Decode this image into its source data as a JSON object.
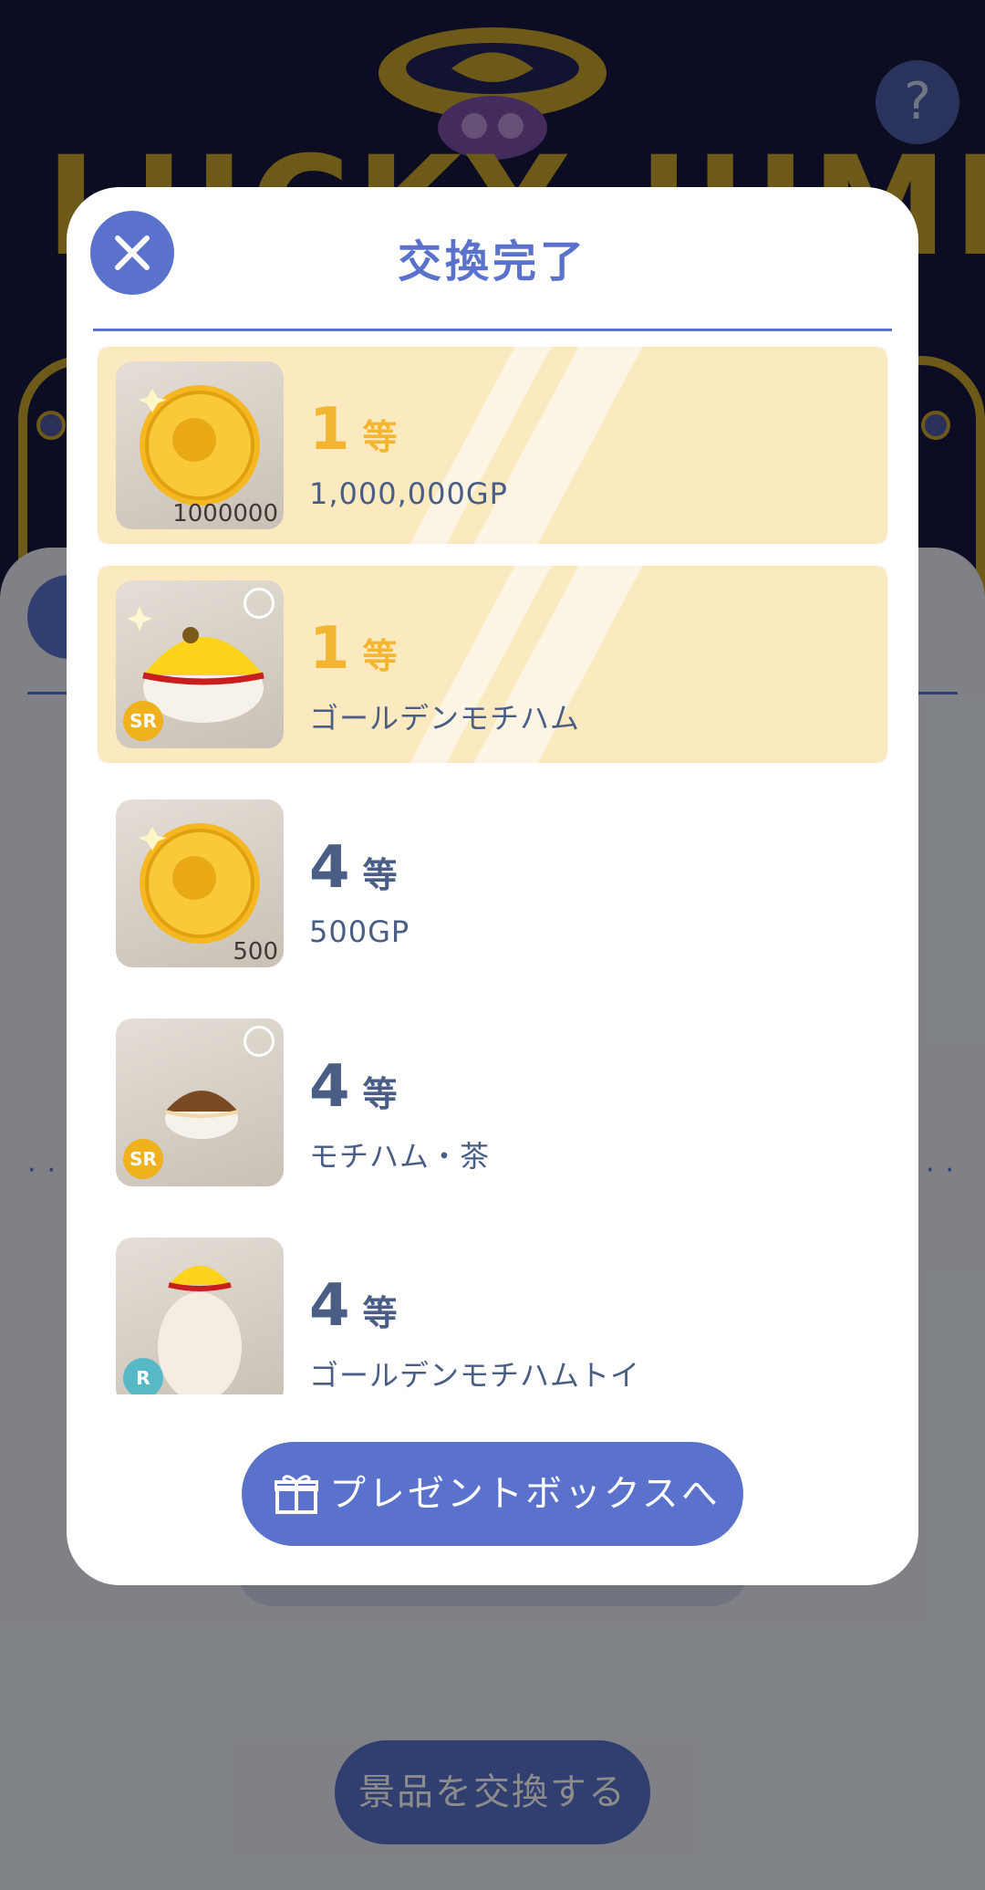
{
  "background": {
    "title_left": "LUCKY",
    "title_right": "JUMP",
    "help_label": "?",
    "exchange_button_label": "景品を交換する"
  },
  "modal": {
    "title": "交換完了",
    "close_icon": "close-icon",
    "items": [
      {
        "rank": "1",
        "rank_suffix": "等",
        "name": "1,000,000GP",
        "quantity": "1000000",
        "style": "gold",
        "thumb": "gold-coin"
      },
      {
        "rank": "1",
        "rank_suffix": "等",
        "name": "ゴールデンモチハム",
        "badge": "SR",
        "style": "gold",
        "thumb": "golden-mochiham"
      },
      {
        "rank": "4",
        "rank_suffix": "等",
        "name": "500GP",
        "quantity": "500",
        "style": "plain",
        "thumb": "gold-coin"
      },
      {
        "rank": "4",
        "rank_suffix": "等",
        "name": "モチハム・茶",
        "badge": "SR",
        "style": "plain",
        "thumb": "brown-mochiham"
      },
      {
        "rank": "4",
        "rank_suffix": "等",
        "name": "ゴールデンモチハムトイ",
        "badge": "R",
        "style": "plain",
        "thumb": "mochiham-toy"
      }
    ],
    "present_button_label": "プレゼントボックスへ",
    "present_icon": "gift-box-icon"
  },
  "colors": {
    "accent": "#5a72cc",
    "gold_row": "#fbe9c0",
    "rank_gold": "#f2b630",
    "rank_plain": "#4a5d85"
  }
}
